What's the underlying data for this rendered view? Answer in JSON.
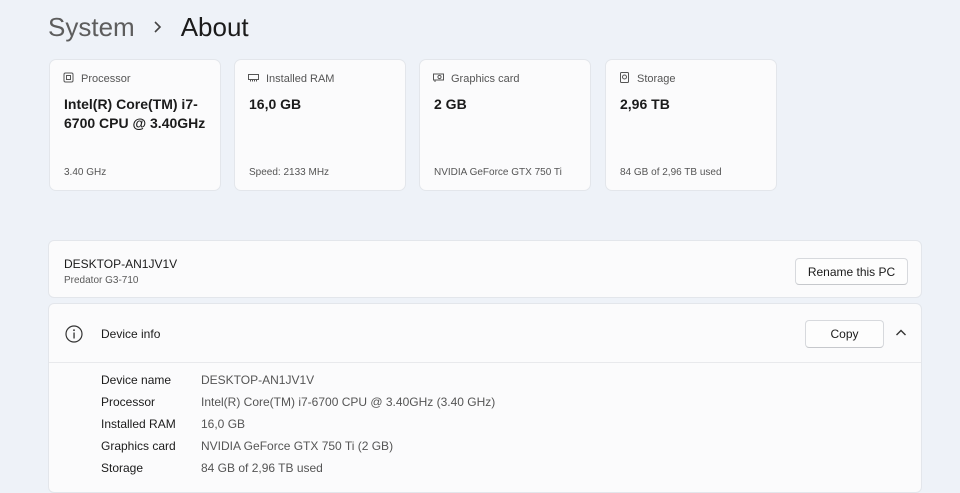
{
  "breadcrumb": {
    "parent": "System",
    "current": "About"
  },
  "cards": [
    {
      "icon": "processor-icon",
      "label": "Processor",
      "value": "Intel(R) Core(TM) i7-6700 CPU @ 3.40GHz",
      "sub": "3.40 GHz"
    },
    {
      "icon": "ram-icon",
      "label": "Installed RAM",
      "value": "16,0 GB",
      "sub": "Speed: 2133 MHz"
    },
    {
      "icon": "graphics-card-icon",
      "label": "Graphics card",
      "value": "2 GB",
      "sub": "NVIDIA GeForce GTX 750 Ti"
    },
    {
      "icon": "storage-icon",
      "label": "Storage",
      "value": "2,96 TB",
      "sub": "84 GB of 2,96 TB used"
    }
  ],
  "pc": {
    "name": "DESKTOP-AN1JV1V",
    "model": "Predator G3-710",
    "rename_label": "Rename this PC"
  },
  "device_info": {
    "title": "Device info",
    "copy_label": "Copy",
    "rows": [
      {
        "label": "Device name",
        "value": "DESKTOP-AN1JV1V"
      },
      {
        "label": "Processor",
        "value": "Intel(R) Core(TM) i7-6700 CPU @ 3.40GHz (3.40 GHz)"
      },
      {
        "label": "Installed RAM",
        "value": "16,0 GB"
      },
      {
        "label": "Graphics card",
        "value": "NVIDIA GeForce GTX 750 Ti (2 GB)"
      },
      {
        "label": "Storage",
        "value": "84 GB of 2,96 TB used"
      }
    ]
  }
}
